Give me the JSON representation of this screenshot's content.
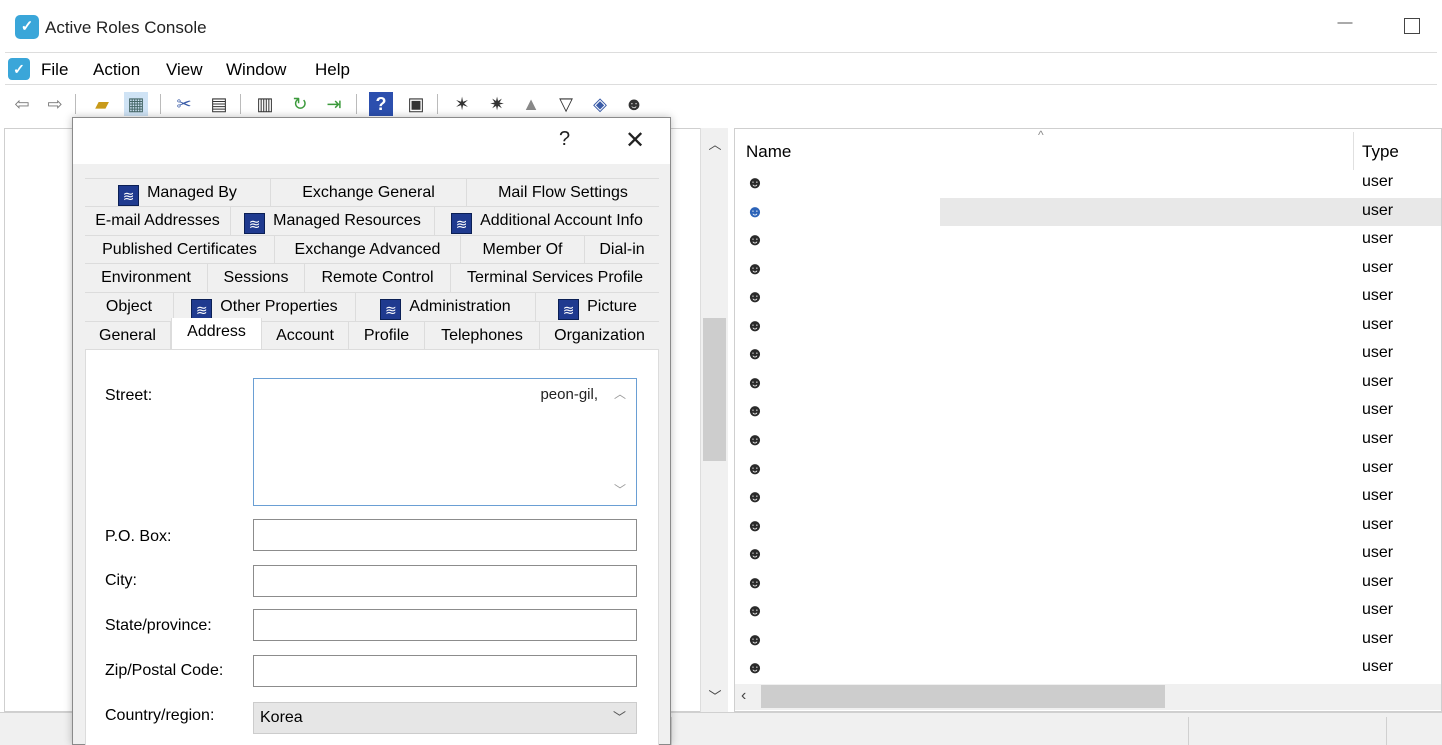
{
  "window": {
    "title": "Active Roles Console",
    "minimize_glyph": "—",
    "app_icon": "active-roles-logo-icon"
  },
  "menu": {
    "items": [
      "File",
      "Action",
      "View",
      "Window",
      "Help"
    ]
  },
  "toolbar": {
    "icons": [
      "back-arrow-icon",
      "forward-arrow-icon",
      "up-folder-icon",
      "show-hide-tree-icon",
      "cut-icon",
      "copy-icon",
      "properties-icon",
      "refresh-icon",
      "export-list-icon",
      "help-icon",
      "console-tree-icon",
      "new-user-icon",
      "new-group-icon",
      "new-computer-icon",
      "filter-icon",
      "find-icon",
      "user-icon"
    ]
  },
  "list": {
    "columns": {
      "name": "Name",
      "type": "Type"
    },
    "rows": [
      {
        "name": "",
        "type": "user",
        "selected": false
      },
      {
        "name": "",
        "type": "user",
        "selected": true
      },
      {
        "name": "",
        "type": "user",
        "selected": false
      },
      {
        "name": "",
        "type": "user",
        "selected": false
      },
      {
        "name": "",
        "type": "user",
        "selected": false
      },
      {
        "name": "",
        "type": "user",
        "selected": false
      },
      {
        "name": "",
        "type": "user",
        "selected": false
      },
      {
        "name": "",
        "type": "user",
        "selected": false
      },
      {
        "name": "",
        "type": "user",
        "selected": false
      },
      {
        "name": "",
        "type": "user",
        "selected": false
      },
      {
        "name": "",
        "type": "user",
        "selected": false
      },
      {
        "name": "",
        "type": "user",
        "selected": false
      },
      {
        "name": "",
        "type": "user",
        "selected": false
      },
      {
        "name": "",
        "type": "user",
        "selected": false
      },
      {
        "name": "",
        "type": "user",
        "selected": false
      },
      {
        "name": "",
        "type": "user",
        "selected": false
      },
      {
        "name": "",
        "type": "user",
        "selected": false
      },
      {
        "name": "",
        "type": "user",
        "selected": false
      }
    ]
  },
  "dialog": {
    "help": "?",
    "close": "✕",
    "tabs": {
      "row1": [
        "Managed By",
        "Exchange General",
        "Mail Flow Settings"
      ],
      "row2": [
        "E-mail Addresses",
        "Managed Resources",
        "Additional Account Info"
      ],
      "row3": [
        "Published Certificates",
        "Exchange Advanced",
        "Member Of",
        "Dial-in"
      ],
      "row4": [
        "Environment",
        "Sessions",
        "Remote Control",
        "Terminal Services Profile"
      ],
      "row5": [
        "Object",
        "Other Properties",
        "Administration",
        "Picture"
      ],
      "row6": [
        "General",
        "Address",
        "Account",
        "Profile",
        "Telephones",
        "Organization"
      ],
      "active": "Address"
    },
    "form": {
      "street_label": "Street:",
      "street_value": "peon-gil,",
      "pobox_label": "P.O. Box:",
      "pobox_value": "",
      "city_label": "City:",
      "city_value": "",
      "state_label": "State/province:",
      "state_value": "",
      "zip_label": "Zip/Postal Code:",
      "zip_value": "",
      "country_label": "Country/region:",
      "country_value": "Korea"
    }
  }
}
